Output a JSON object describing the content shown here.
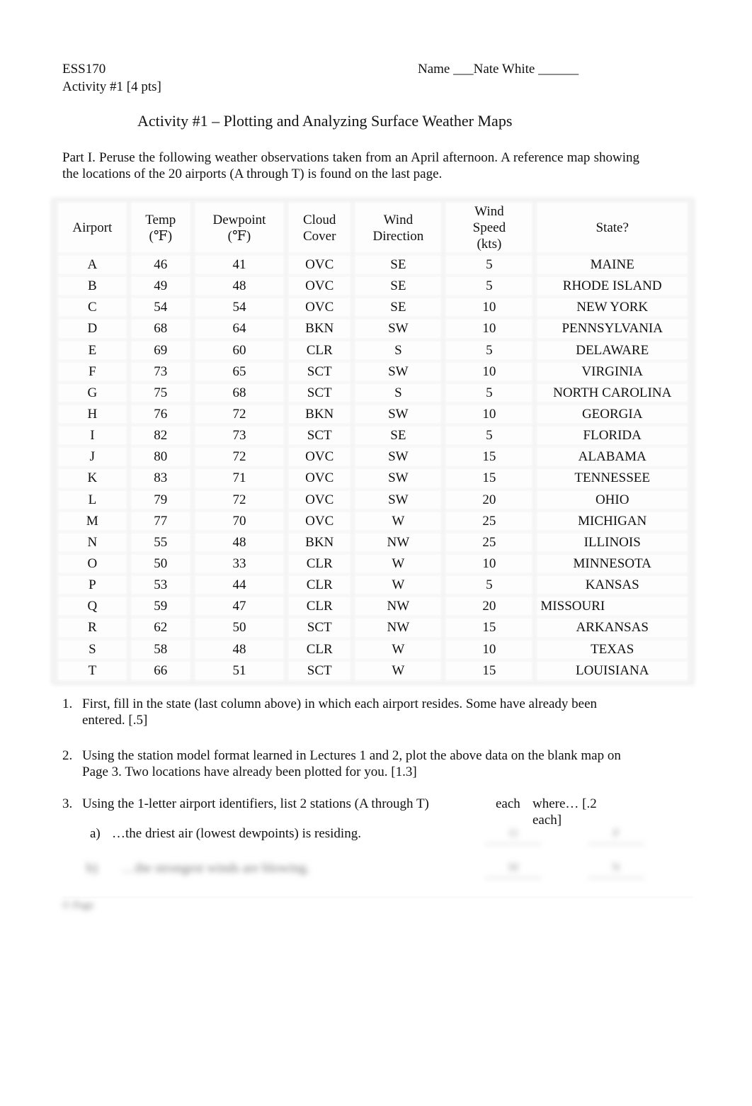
{
  "header": {
    "course": "ESS170",
    "activity_points": "Activity #1 [4 pts]",
    "name_label": "Name ___Nate White ______"
  },
  "title": "Activity #1 – Plotting and Analyzing Surface Weather Maps",
  "intro": "Part I.  Peruse the following weather observations taken from an April afternoon. A reference map showing the locations of the 20 airports (A through T) is found on the last page.",
  "table": {
    "headers": {
      "airport": "Airport",
      "temp_1": "Temp",
      "temp_2": "(℉)",
      "dew_1": "Dewpoint",
      "dew_2": "(℉)",
      "cloud_1": "Cloud",
      "cloud_2": "Cover",
      "dir_1": "Wind",
      "dir_2": "Direction",
      "speed_1": "Wind",
      "speed_2": "Speed",
      "speed_3": "(kts)",
      "state": "State?"
    },
    "rows": [
      {
        "airport": "A",
        "temp": "46",
        "dew": "41",
        "cloud": "OVC",
        "dir": "SE",
        "speed": "5",
        "state": "MAINE"
      },
      {
        "airport": "B",
        "temp": "49",
        "dew": "48",
        "cloud": "OVC",
        "dir": "SE",
        "speed": "5",
        "state": "RHODE ISLAND"
      },
      {
        "airport": "C",
        "temp": "54",
        "dew": "54",
        "cloud": "OVC",
        "dir": "SE",
        "speed": "10",
        "state": "NEW YORK"
      },
      {
        "airport": "D",
        "temp": "68",
        "dew": "64",
        "cloud": "BKN",
        "dir": "SW",
        "speed": "10",
        "state": "PENNSYLVANIA"
      },
      {
        "airport": "E",
        "temp": "69",
        "dew": "60",
        "cloud": "CLR",
        "dir": "S",
        "speed": "5",
        "state": "DELAWARE"
      },
      {
        "airport": "F",
        "temp": "73",
        "dew": "65",
        "cloud": "SCT",
        "dir": "SW",
        "speed": "10",
        "state": "VIRGINIA"
      },
      {
        "airport": "G",
        "temp": "75",
        "dew": "68",
        "cloud": "SCT",
        "dir": "S",
        "speed": "5",
        "state": "NORTH CAROLINA"
      },
      {
        "airport": "H",
        "temp": "76",
        "dew": "72",
        "cloud": "BKN",
        "dir": "SW",
        "speed": "10",
        "state": "GEORGIA"
      },
      {
        "airport": "I",
        "temp": "82",
        "dew": "73",
        "cloud": "SCT",
        "dir": "SE",
        "speed": "5",
        "state": "FLORIDA"
      },
      {
        "airport": "J",
        "temp": "80",
        "dew": "72",
        "cloud": "OVC",
        "dir": "SW",
        "speed": "15",
        "state": "ALABAMA"
      },
      {
        "airport": "K",
        "temp": "83",
        "dew": "71",
        "cloud": "OVC",
        "dir": "SW",
        "speed": "15",
        "state": "TENNESSEE"
      },
      {
        "airport": "L",
        "temp": "79",
        "dew": "72",
        "cloud": "OVC",
        "dir": "SW",
        "speed": "20",
        "state": "OHIO"
      },
      {
        "airport": "M",
        "temp": "77",
        "dew": "70",
        "cloud": "OVC",
        "dir": "W",
        "speed": "25",
        "state": "MICHIGAN"
      },
      {
        "airport": "N",
        "temp": "55",
        "dew": "48",
        "cloud": "BKN",
        "dir": "NW",
        "speed": "25",
        "state": "ILLINOIS"
      },
      {
        "airport": "O",
        "temp": "50",
        "dew": "33",
        "cloud": "CLR",
        "dir": "W",
        "speed": "10",
        "state": "MINNESOTA"
      },
      {
        "airport": "P",
        "temp": "53",
        "dew": "44",
        "cloud": "CLR",
        "dir": "W",
        "speed": "5",
        "state": "KANSAS"
      },
      {
        "airport": "Q",
        "temp": "59",
        "dew": "47",
        "cloud": "CLR",
        "dir": "NW",
        "speed": "20",
        "state": "MISSOURI",
        "state_left_aligned": true
      },
      {
        "airport": "R",
        "temp": "62",
        "dew": "50",
        "cloud": "SCT",
        "dir": "NW",
        "speed": "15",
        "state": "ARKANSAS"
      },
      {
        "airport": "S",
        "temp": "58",
        "dew": "48",
        "cloud": "CLR",
        "dir": "W",
        "speed": "10",
        "state": "TEXAS"
      },
      {
        "airport": "T",
        "temp": "66",
        "dew": "51",
        "cloud": "SCT",
        "dir": "W",
        "speed": "15",
        "state": "LOUISIANA"
      }
    ]
  },
  "questions": {
    "q1": {
      "num": "1.",
      "text": "First, fill in the state (last column above) in which each airport resides. Some have already been entered. [.5]"
    },
    "q2": {
      "num": "2.",
      "text": "Using the station model format learned in Lectures 1 and 2, plot the above data on the blank map on Page 3. Two locations have already been plotted for you. [1.3]"
    },
    "q3": {
      "num": "3.",
      "text": "Using the 1-letter airport identifiers, list 2 stations (A through T)",
      "extra1": "each",
      "extra2": "where… [.2 each]"
    },
    "q3a": {
      "label": "a)",
      "text": "…the driest air (lowest dewpoints) is residing.",
      "answer1": "O",
      "answer2": "P"
    },
    "q3b": {
      "label": "b)",
      "text": "…the strongest winds are blowing.",
      "answer1": "M",
      "answer2": "N"
    },
    "footer": "© Page"
  }
}
